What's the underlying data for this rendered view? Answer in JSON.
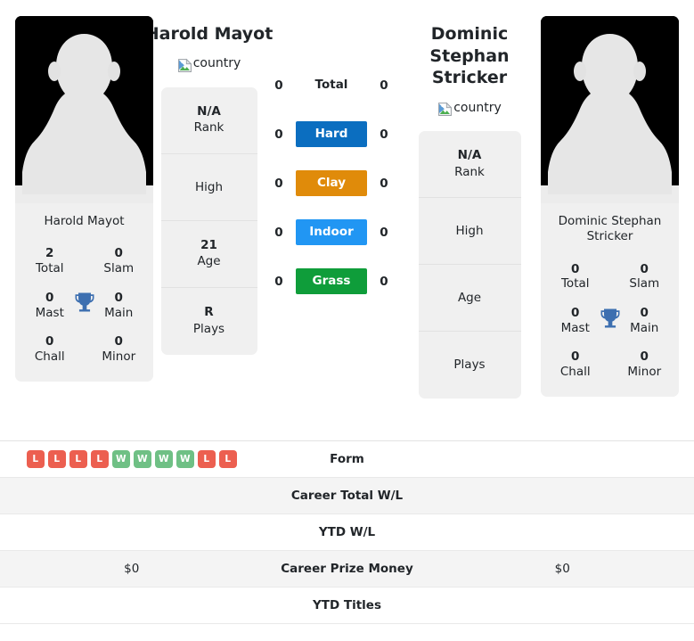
{
  "players": {
    "left": {
      "name": "Harold Mayot",
      "photo_caption": "Harold Mayot",
      "flag_alt": "country",
      "titles": {
        "total_value": "2",
        "total_label": "Total",
        "slam_value": "0",
        "slam_label": "Slam",
        "mast_value": "0",
        "mast_label": "Mast",
        "main_value": "0",
        "main_label": "Main",
        "chall_value": "0",
        "chall_label": "Chall",
        "minor_value": "0",
        "minor_label": "Minor"
      },
      "info": [
        {
          "value": "N/A",
          "label": "Rank"
        },
        {
          "value": "",
          "label": "High"
        },
        {
          "value": "21",
          "label": "Age"
        },
        {
          "value": "R",
          "label": "Plays"
        }
      ]
    },
    "right": {
      "name": "Dominic Stephan Stricker",
      "photo_caption": "Dominic Stephan Stricker",
      "flag_alt": "country",
      "titles": {
        "total_value": "0",
        "total_label": "Total",
        "slam_value": "0",
        "slam_label": "Slam",
        "mast_value": "0",
        "mast_label": "Mast",
        "main_value": "0",
        "main_label": "Main",
        "chall_value": "0",
        "chall_label": "Chall",
        "minor_value": "0",
        "minor_label": "Minor"
      },
      "info": [
        {
          "value": "N/A",
          "label": "Rank"
        },
        {
          "value": "",
          "label": "High"
        },
        {
          "value": "",
          "label": "Age"
        },
        {
          "value": "",
          "label": "Plays"
        }
      ]
    }
  },
  "surfaces": [
    {
      "label": "Total",
      "left": "0",
      "right": "0",
      "color": "transparent"
    },
    {
      "label": "Hard",
      "left": "0",
      "right": "0",
      "color": "#0b6ec0"
    },
    {
      "label": "Clay",
      "left": "0",
      "right": "0",
      "color": "#e08b0a"
    },
    {
      "label": "Indoor",
      "left": "0",
      "right": "0",
      "color": "#2196f3"
    },
    {
      "label": "Grass",
      "left": "0",
      "right": "0",
      "color": "#0f9d3a"
    }
  ],
  "comparison_rows": [
    {
      "label": "Form",
      "left": "",
      "right": ""
    },
    {
      "label": "Career Total W/L",
      "left": "",
      "right": ""
    },
    {
      "label": "YTD W/L",
      "left": "",
      "right": ""
    },
    {
      "label": "Career Prize Money",
      "left": "$0",
      "right": "$0"
    },
    {
      "label": "YTD Titles",
      "left": "",
      "right": ""
    }
  ],
  "form": {
    "left_results": [
      "L",
      "L",
      "L",
      "L",
      "W",
      "W",
      "W",
      "W",
      "L",
      "L"
    ],
    "right_results": [],
    "win_color": "#6fc085",
    "loss_color": "#ec5f50"
  },
  "theme": {
    "card_bg": "#f0f0f0",
    "row_shade": "#f4f4f4",
    "trophy_color": "#3d6fb0",
    "text": "#212529"
  }
}
